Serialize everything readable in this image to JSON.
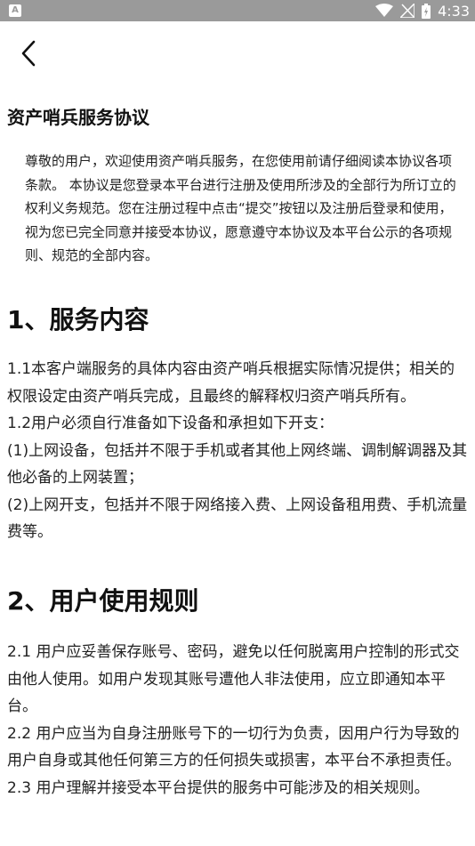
{
  "status_bar": {
    "time": "4:33",
    "app_indicator": "A",
    "icons": [
      "wifi-icon",
      "signal-icon",
      "battery-icon"
    ]
  },
  "nav": {
    "back_icon": "chevron-left-icon"
  },
  "document": {
    "title": "资产哨兵服务协议",
    "intro": "尊敬的用户，欢迎使用资产哨兵服务，在您使用前请仔细阅读本协议各项条款。 本协议是您登录本平台进行注册及使用所涉及的全部行为所订立的权利义务规范。您在注册过程中点击“提交”按钮以及注册后登录和使用，视为您已完全同意并接受本协议，愿意遵守本协议及本平台公示的各项规则、规范的全部内容。",
    "sections": [
      {
        "heading": "1、服务内容",
        "paragraphs": [
          "1.1本客户端服务的具体内容由资产哨兵根据实际情况提供；相关的权限设定由资产哨兵完成，且最终的解释权归资产哨兵所有。",
          "1.2用户必须自行准备如下设备和承担如下开支：",
          "(1)上网设备，包括并不限于手机或者其他上网终端、调制解调器及其他必备的上网装置；",
          "(2)上网开支，包括并不限于网络接入费、上网设备租用费、手机流量费等。"
        ]
      },
      {
        "heading": "2、用户使用规则",
        "paragraphs": [
          "2.1 用户应妥善保存账号、密码，避免以任何脱离用户控制的形式交由他人使用。如用户发现其账号遭他人非法使用，应立即通知本平台。",
          "2.2 用户应当为自身注册账号下的一切行为负责，因用户行为导致的用户自身或其他任何第三方的任何损失或损害，本平台不承担责任。",
          "2.3 用户理解并接受本平台提供的服务中可能涉及的相关规则。"
        ]
      }
    ]
  }
}
